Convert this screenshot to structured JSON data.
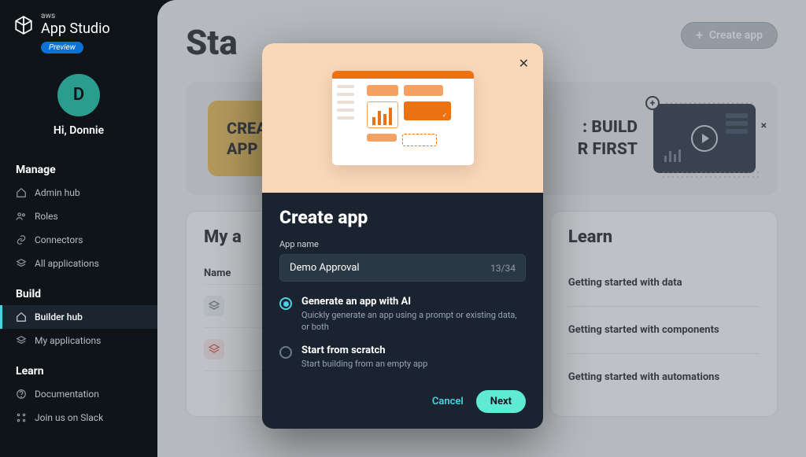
{
  "brand": {
    "aws": "aws",
    "name": "App Studio",
    "preview": "Preview"
  },
  "user": {
    "initial": "D",
    "greeting": "Hi, Donnie"
  },
  "nav": {
    "manage_heading": "Manage",
    "build_heading": "Build",
    "learn_heading": "Learn",
    "admin_hub": "Admin hub",
    "roles": "Roles",
    "connectors": "Connectors",
    "all_apps": "All applications",
    "builder_hub": "Builder hub",
    "my_apps": "My applications",
    "documentation": "Documentation",
    "slack": "Join us on Slack"
  },
  "header": {
    "page_title_visible": "Sta",
    "create_app": "Create app"
  },
  "banner": {
    "yellow_line1": "CREA",
    "yellow_line2": "APP",
    "right_line1": ": BUILD",
    "right_line2": "R FIRST"
  },
  "myapps": {
    "heading_visible": "My a",
    "col_name": "Name"
  },
  "learn": {
    "heading": "Learn",
    "item1": "Getting started with data",
    "item2": "Getting started with components",
    "item3": "Getting started with automations"
  },
  "modal": {
    "title": "Create app",
    "field_label": "App name",
    "input_value": "Demo Approval",
    "char_count": "13/34",
    "opt1_title": "Generate an app with AI",
    "opt1_desc": "Quickly generate an app using a prompt or existing data, or both",
    "opt2_title": "Start from scratch",
    "opt2_desc": "Start building from an empty app",
    "cancel": "Cancel",
    "next": "Next"
  }
}
